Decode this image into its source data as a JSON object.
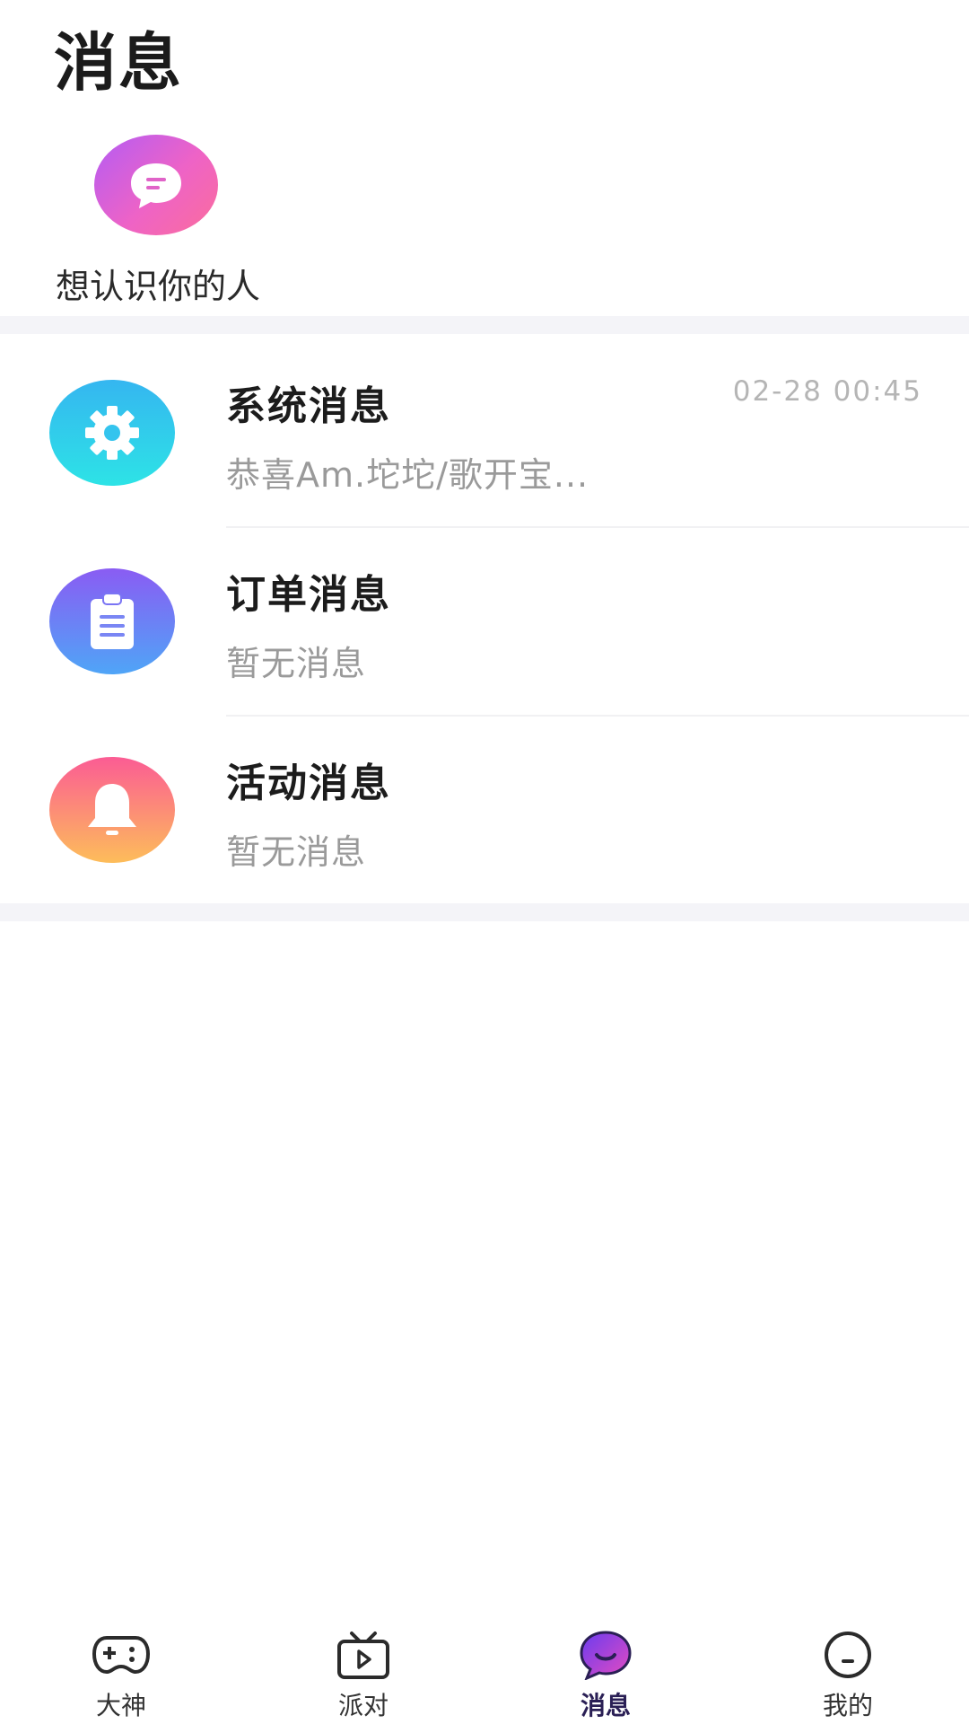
{
  "header": {
    "title": "消息"
  },
  "shortcut": {
    "label": "想认识你的人",
    "icon": "chat-bubble-icon"
  },
  "messages": [
    {
      "title": "系统消息",
      "preview": "恭喜Am.坨坨/歌开宝...",
      "time": "02-28 00:45",
      "icon": "gear-icon"
    },
    {
      "title": "订单消息",
      "preview": "暂无消息",
      "icon": "clipboard-icon"
    },
    {
      "title": "活动消息",
      "preview": "暂无消息",
      "icon": "bell-icon"
    }
  ],
  "tabbar": {
    "tabs": [
      {
        "label": "大神",
        "icon": "gamepad-icon"
      },
      {
        "label": "派对",
        "icon": "tv-play-icon"
      },
      {
        "label": "消息",
        "icon": "message-bubble-icon",
        "active": true
      },
      {
        "label": "我的",
        "icon": "face-icon"
      }
    ]
  },
  "colors": {
    "active_tab": "#2a1f55",
    "active_icon_gradient": [
      "#6a3cf0",
      "#e64bc0"
    ],
    "divider": "#f4f4f8"
  }
}
